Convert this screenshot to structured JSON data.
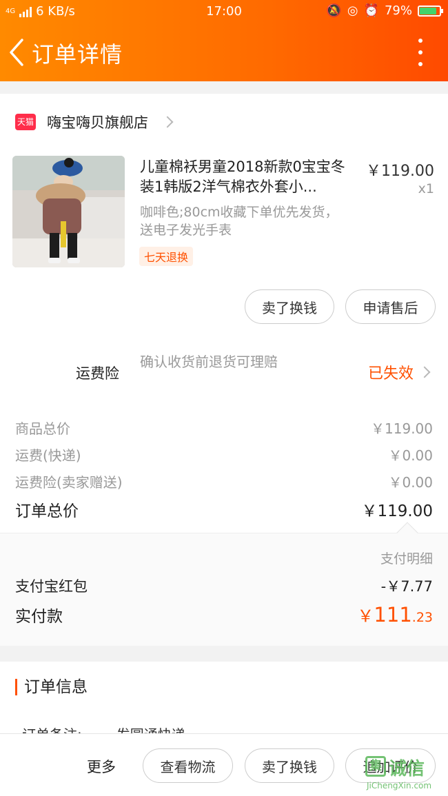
{
  "status_bar": {
    "network": "4G",
    "speed": "6 KB/s",
    "time": "17:00",
    "battery": "79%"
  },
  "nav": {
    "title": "订单详情"
  },
  "shop": {
    "badge": "天猫",
    "name": "嗨宝嗨贝旗舰店"
  },
  "product": {
    "name": "儿童棉袄男童2018新款0宝宝冬装1韩版2洋气棉衣外套小...",
    "price": "￥119.00",
    "qty": "x1",
    "sku": "咖啡色;80cm收藏下单优先发货，送电子发光手表",
    "tag": "七天退换"
  },
  "item_actions": {
    "sell": "卖了换钱",
    "aftersale": "申请售后"
  },
  "insurance": {
    "label": "运费险",
    "desc": "确认收货前退货可理赔",
    "status": "已失效"
  },
  "price_rows": [
    {
      "label": "商品总价",
      "value": "￥119.00"
    },
    {
      "label": "运费(快递)",
      "value": "￥0.00"
    },
    {
      "label": "运费险(卖家赠送)",
      "value": "￥0.00"
    }
  ],
  "order_total": {
    "label": "订单总价",
    "value": "￥119.00"
  },
  "payment": {
    "detail_link": "支付明细",
    "redpacket_label": "支付宝红包",
    "redpacket_value": "-￥7.77",
    "actual_label": "实付款",
    "actual_currency": "￥",
    "actual_int": "111",
    "actual_dec": ".23"
  },
  "order_info": {
    "title": "订单信息",
    "remark_label": "订单备注:",
    "remark_value": "发圆通快递"
  },
  "bottom": {
    "more": "更多",
    "logistics": "查看物流",
    "sell": "卖了换钱",
    "review": "追加评价"
  },
  "watermark": {
    "logo": "集",
    "name": "诚信",
    "url": "JiChengXin.com"
  }
}
